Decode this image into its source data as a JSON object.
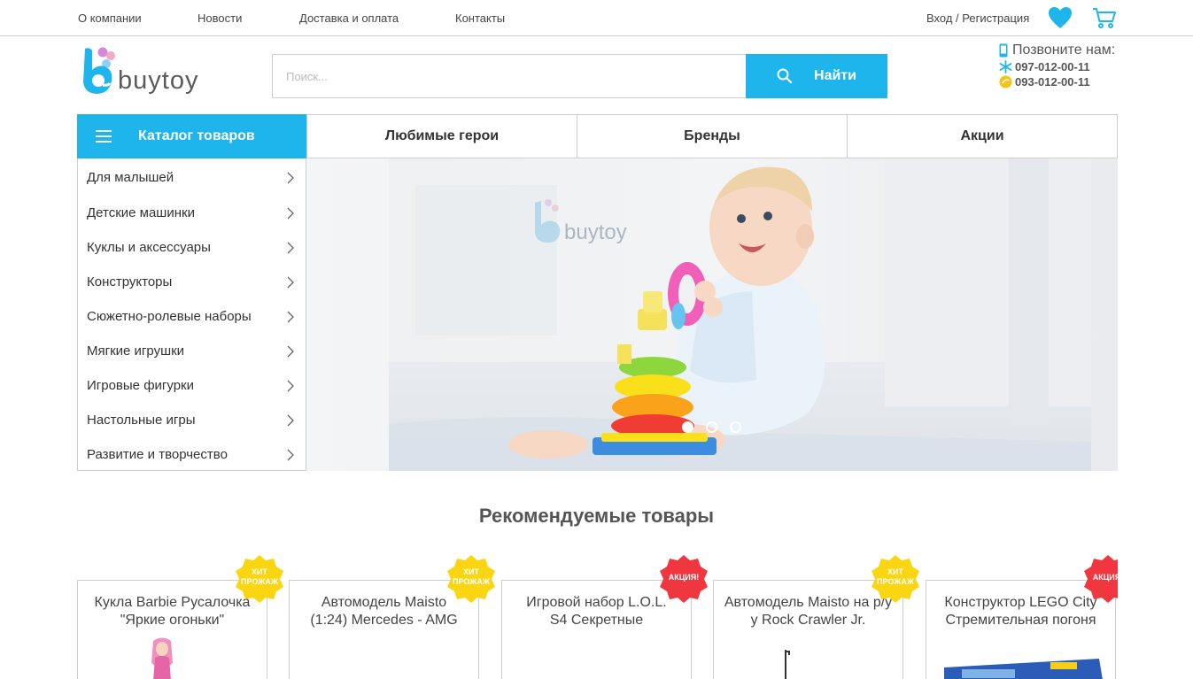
{
  "topnav": {
    "links": [
      "О компании",
      "Новости",
      "Доставка и оплата",
      "Контакты"
    ],
    "login": "Вход / Регистрация"
  },
  "header": {
    "logo_text": "buytoy",
    "search_placeholder": "Поиск...",
    "search_button": "Найти",
    "call_label": "Позвоните нам:",
    "phones": [
      "097-012-00-11",
      "093-012-00-11"
    ]
  },
  "nav": {
    "catalog_label": "Каталог товаров",
    "tabs": [
      "Любимые герои",
      "Бренды",
      "Акции"
    ]
  },
  "sidebar": {
    "items": [
      "Для малышей",
      "Детские машинки",
      "Куклы и аксессуары",
      "Конструкторы",
      "Сюжетно-ролевые наборы",
      "Мягкие игрушки",
      "Игровые фигурки",
      "Настольные игры",
      "Развитие и творчество"
    ]
  },
  "banner": {
    "watermark": "buytoy",
    "slides": 3,
    "active_slide": 1
  },
  "recommended": {
    "title": "Рекомендуемые товары",
    "products": [
      {
        "name_line1": "Кукла Barbie Русалочка",
        "name_line2": "\"Яркие огоньки\"",
        "badge": "ХИТ ПРОЖАЖ"
      },
      {
        "name_line1": "Автомодель Maisto",
        "name_line2": "(1:24) Mercedes - AMG",
        "badge": "ХИТ ПРОЖАЖ"
      },
      {
        "name_line1": "Игровой набор L.O.L.",
        "name_line2": "S4 Секретные",
        "badge": "АКЦИЯ!"
      },
      {
        "name_line1": "Автомодель Maisto на р/у",
        "name_line2": "у Rock Crawler Jr.",
        "badge": "ХИТ ПРОЖАЖ"
      },
      {
        "name_line1": "Конструктор LEGO City",
        "name_line2": "Стремительная погоня",
        "badge": "АКЦИЯ!"
      }
    ]
  },
  "colors": {
    "accent": "#1db5ec",
    "badge_hit": "#f9d512",
    "badge_sale": "#f0363f"
  }
}
